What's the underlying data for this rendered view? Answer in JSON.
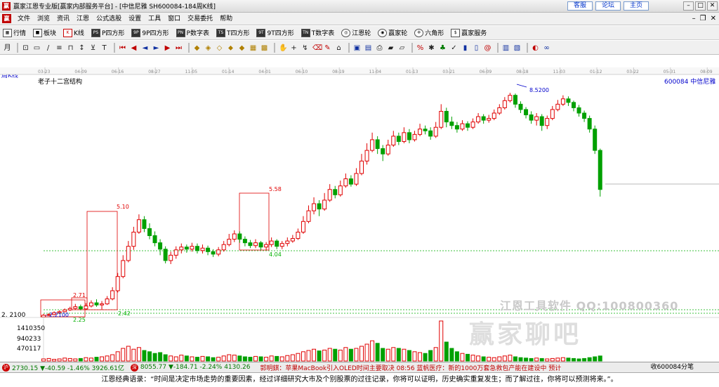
{
  "window": {
    "title": "赢家江恩专业版[赢家内部服务平台] - [中信尼雅  SH600084-184周K线]",
    "links": [
      "客服",
      "论坛",
      "主页"
    ]
  },
  "menu": [
    "文件",
    "浏览",
    "资讯",
    "江恩",
    "公式选股",
    "设置",
    "工具",
    "窗口",
    "交易委托",
    "帮助"
  ],
  "toolbar1": [
    {
      "icon": "grid-icon",
      "glyph": "▦",
      "label": "行情"
    },
    {
      "icon": "blocks-icon",
      "glyph": "■",
      "label": "板块"
    },
    {
      "icon": "kline-icon",
      "glyph": "K",
      "label": "K线"
    },
    {
      "icon": "p-square-icon",
      "glyph": "PS",
      "label": "P四方形"
    },
    {
      "icon": "9p-square-icon",
      "glyph": "9P",
      "label": "9P四方形"
    },
    {
      "icon": "p-number-table-icon",
      "glyph": "PN",
      "label": "P数字表"
    },
    {
      "icon": "t-square-icon",
      "glyph": "TS",
      "label": "T四方形"
    },
    {
      "icon": "9t-square-icon",
      "glyph": "9T",
      "label": "9T四方形"
    },
    {
      "icon": "t-number-table-icon",
      "glyph": "TN",
      "label": "T数字表"
    },
    {
      "icon": "gann-wheel-icon",
      "glyph": "◎",
      "label": "江恩轮"
    },
    {
      "icon": "winner-wheel-icon",
      "glyph": "◉",
      "label": "赢家轮"
    },
    {
      "icon": "hexagon-icon",
      "glyph": "✡",
      "label": "六角形"
    },
    {
      "icon": "dollar-icon",
      "glyph": "$",
      "label": "赢家服务"
    }
  ],
  "chart": {
    "period_label": "周K线",
    "title": "老子十二宫结构",
    "stock": "600084  中信尼雅",
    "date_axis": [
      "03-23",
      "04-09",
      "06-16",
      "08-27",
      "11-05",
      "01-14",
      "04-01",
      "06-10",
      "08-19",
      "11-04",
      "01-13",
      "03-21",
      "06-09",
      "08-18",
      "11-03",
      "01-12",
      "03-22",
      "05-31",
      "08-09"
    ],
    "price_left_label": "2. 2100",
    "volume_labels": [
      "1410350",
      "940233",
      "470117"
    ],
    "watermark": "江恩工具软件  QQ:100800360",
    "watermark_logo": "赢家聊吧"
  },
  "chart_data": {
    "type": "candlestick",
    "unit": "weekly",
    "annotations": {
      "peak": "8.5200",
      "box1_low": "2.2100",
      "box1_low_b": "2.25",
      "box2_top": "2.71",
      "box2_bottom": "2.42",
      "box3_top": "5.10",
      "box4_top": "5.58",
      "box4_bottom": "4.04"
    },
    "ylim": [
      2.0,
      8.8
    ],
    "candles": [
      [
        2.21,
        2.26,
        2.2,
        2.3
      ],
      [
        2.26,
        2.28,
        2.24,
        2.32
      ],
      [
        2.28,
        2.33,
        2.26,
        2.37
      ],
      [
        2.33,
        2.36,
        2.3,
        2.4
      ],
      [
        2.36,
        2.41,
        2.34,
        2.45
      ],
      [
        2.41,
        2.45,
        2.38,
        2.5
      ],
      [
        2.45,
        2.5,
        2.42,
        2.58
      ],
      [
        2.5,
        2.44,
        2.4,
        2.56
      ],
      [
        2.44,
        2.52,
        2.42,
        2.6
      ],
      [
        2.52,
        2.61,
        2.48,
        2.68
      ],
      [
        2.61,
        2.55,
        2.5,
        2.71
      ],
      [
        2.55,
        2.58,
        2.42,
        2.66
      ],
      [
        2.58,
        2.72,
        2.55,
        2.8
      ],
      [
        2.72,
        2.95,
        2.68,
        3.05
      ],
      [
        2.95,
        3.35,
        2.9,
        3.45
      ],
      [
        3.35,
        3.8,
        3.3,
        3.95
      ],
      [
        3.8,
        4.2,
        3.75,
        4.35
      ],
      [
        4.2,
        4.6,
        4.1,
        4.75
      ],
      [
        4.6,
        4.95,
        4.55,
        5.1
      ],
      [
        4.95,
        4.7,
        4.6,
        5.05
      ],
      [
        4.7,
        4.5,
        4.4,
        4.85
      ],
      [
        4.5,
        4.3,
        4.2,
        4.62
      ],
      [
        4.3,
        4.12,
        3.95,
        4.4
      ],
      [
        4.12,
        3.8,
        3.72,
        4.2
      ],
      [
        3.8,
        3.95,
        3.7,
        4.05
      ],
      [
        3.95,
        4.1,
        3.85,
        4.2
      ],
      [
        4.1,
        4.18,
        4.0,
        4.28
      ],
      [
        4.18,
        4.12,
        4.02,
        4.25
      ],
      [
        4.12,
        4.2,
        4.05,
        4.3
      ],
      [
        4.2,
        4.08,
        4.0,
        4.28
      ],
      [
        4.08,
        4.15,
        4.0,
        4.25
      ],
      [
        4.15,
        4.05,
        3.95,
        4.22
      ],
      [
        4.05,
        3.98,
        3.9,
        4.12
      ],
      [
        3.98,
        4.1,
        3.92,
        4.18
      ],
      [
        4.1,
        4.25,
        4.05,
        4.35
      ],
      [
        4.25,
        4.4,
        4.2,
        4.55
      ],
      [
        4.4,
        4.55,
        4.32,
        4.65
      ],
      [
        4.55,
        4.4,
        4.3,
        4.62
      ],
      [
        4.4,
        4.3,
        4.2,
        4.48
      ],
      [
        4.3,
        4.22,
        4.15,
        4.38
      ],
      [
        4.22,
        4.3,
        4.15,
        4.4
      ],
      [
        4.3,
        4.18,
        4.1,
        4.35
      ],
      [
        4.18,
        4.25,
        4.1,
        4.32
      ],
      [
        4.25,
        4.35,
        4.18,
        4.45
      ],
      [
        4.35,
        4.2,
        4.12,
        4.4
      ],
      [
        4.2,
        4.28,
        4.12,
        4.35
      ],
      [
        4.28,
        4.35,
        4.2,
        4.45
      ],
      [
        4.35,
        4.42,
        4.3,
        4.52
      ],
      [
        4.42,
        4.6,
        4.38,
        4.7
      ],
      [
        4.6,
        4.9,
        4.55,
        5.05
      ],
      [
        4.9,
        5.2,
        4.85,
        5.35
      ],
      [
        5.2,
        5.4,
        5.1,
        5.58
      ],
      [
        5.4,
        5.25,
        5.05,
        5.5
      ],
      [
        5.25,
        5.5,
        5.2,
        5.7
      ],
      [
        5.5,
        5.8,
        5.45,
        5.95
      ],
      [
        5.8,
        5.65,
        5.55,
        5.9
      ],
      [
        5.65,
        5.9,
        5.6,
        6.05
      ],
      [
        5.9,
        6.1,
        5.85,
        6.25
      ],
      [
        6.1,
        5.95,
        5.88,
        6.2
      ],
      [
        5.95,
        6.25,
        5.9,
        6.4
      ],
      [
        6.25,
        6.6,
        6.2,
        6.8
      ],
      [
        6.6,
        6.9,
        6.5,
        7.1
      ],
      [
        6.9,
        7.2,
        6.85,
        7.4
      ],
      [
        7.2,
        6.95,
        6.8,
        7.3
      ],
      [
        6.95,
        6.8,
        6.6,
        7.05
      ],
      [
        6.8,
        7.05,
        6.75,
        7.2
      ],
      [
        7.05,
        7.3,
        7.0,
        7.45
      ],
      [
        7.3,
        7.15,
        7.05,
        7.4
      ],
      [
        7.15,
        7.4,
        7.1,
        7.55
      ],
      [
        7.4,
        7.2,
        7.1,
        7.5
      ],
      [
        7.2,
        7.35,
        7.15,
        7.45
      ],
      [
        7.35,
        7.5,
        7.3,
        7.65
      ],
      [
        7.5,
        7.45,
        7.35,
        7.6
      ],
      [
        7.45,
        7.3,
        7.2,
        7.55
      ],
      [
        7.3,
        7.55,
        7.25,
        7.7
      ],
      [
        7.55,
        8.0,
        7.5,
        8.2
      ],
      [
        8.0,
        7.7,
        7.55,
        8.1
      ],
      [
        7.7,
        7.6,
        7.5,
        7.85
      ],
      [
        7.6,
        7.5,
        7.4,
        7.7
      ],
      [
        7.5,
        7.65,
        7.45,
        7.75
      ],
      [
        7.65,
        7.55,
        7.45,
        7.72
      ],
      [
        7.55,
        7.7,
        7.5,
        7.8
      ],
      [
        7.7,
        7.85,
        7.65,
        7.95
      ],
      [
        7.85,
        7.75,
        7.65,
        7.92
      ],
      [
        7.75,
        7.8,
        7.68,
        7.9
      ],
      [
        7.8,
        7.95,
        7.75,
        8.05
      ],
      [
        7.95,
        8.1,
        7.9,
        8.2
      ],
      [
        8.1,
        8.3,
        8.05,
        8.4
      ],
      [
        8.3,
        8.45,
        8.25,
        8.52
      ],
      [
        8.45,
        8.2,
        8.1,
        8.5
      ],
      [
        8.2,
        8.05,
        7.95,
        8.28
      ],
      [
        8.05,
        7.9,
        7.8,
        8.12
      ],
      [
        7.9,
        7.75,
        7.65,
        8.0
      ],
      [
        7.75,
        7.85,
        7.6,
        7.95
      ],
      [
        7.85,
        7.6,
        7.45,
        7.92
      ],
      [
        7.6,
        7.8,
        7.5,
        7.88
      ],
      [
        7.8,
        8.05,
        7.75,
        8.15
      ],
      [
        8.05,
        8.2,
        8.0,
        8.32
      ],
      [
        8.2,
        8.35,
        8.15,
        8.45
      ],
      [
        8.35,
        8.25,
        8.15,
        8.42
      ],
      [
        8.25,
        8.1,
        8.0,
        8.3
      ],
      [
        8.1,
        7.95,
        7.85,
        8.18
      ],
      [
        7.95,
        7.8,
        7.7,
        8.02
      ],
      [
        7.8,
        7.5,
        7.4,
        7.88
      ],
      [
        7.5,
        6.9,
        6.8,
        7.6
      ],
      [
        6.9,
        5.8,
        5.6,
        6.95
      ]
    ],
    "volume": [
      0.05,
      0.06,
      0.04,
      0.05,
      0.07,
      0.06,
      0.05,
      0.06,
      0.08,
      0.07,
      0.09,
      0.1,
      0.12,
      0.15,
      0.22,
      0.3,
      0.35,
      0.28,
      0.32,
      0.25,
      0.22,
      0.18,
      0.2,
      0.15,
      0.12,
      0.1,
      0.14,
      0.12,
      0.1,
      0.09,
      0.11,
      0.1,
      0.08,
      0.09,
      0.12,
      0.15,
      0.14,
      0.12,
      0.1,
      0.09,
      0.11,
      0.1,
      0.09,
      0.12,
      0.11,
      0.1,
      0.13,
      0.15,
      0.18,
      0.22,
      0.25,
      0.28,
      0.24,
      0.26,
      0.3,
      0.28,
      0.26,
      0.32,
      0.28,
      0.3,
      0.35,
      0.4,
      0.48,
      0.42,
      0.3,
      0.28,
      0.32,
      0.3,
      0.28,
      0.25,
      0.22,
      0.2,
      0.18,
      0.25,
      0.32,
      0.95,
      0.45,
      0.3,
      0.22,
      0.18,
      0.16,
      0.14,
      0.12,
      0.1,
      0.09,
      0.08,
      0.1,
      0.12,
      0.14,
      0.1,
      0.08,
      0.07,
      0.06,
      0.07,
      0.06,
      0.05,
      0.06,
      0.07,
      0.08,
      0.07,
      0.06,
      0.05,
      0.06,
      0.08,
      0.1,
      0.12
    ]
  },
  "statusbar": {
    "sh_index": "2730.15",
    "sh_change": "▼-40.59",
    "sh_pct": "-1.46%",
    "sh_amount": "3926.61亿",
    "sz_index": "8055.77",
    "sz_change": "▼-184.71",
    "sz_pct": "-2.24%",
    "sz_amount": "4130.26",
    "ticker": "郭明錤：苹果MacBook引入OLED时间主要取决     08:56  蓝帆医疗：新的1000万套急救包产能在建设中 预计",
    "right_text": "收600084分笔"
  },
  "quote": "江恩经典语录：“时间是决定市场走势的重要因素，经过详细研究大市及个别股票的过往记录，你将可以证明，历史确实重复发生；而了解过往，你将可以预测将来。”。",
  "colors": {
    "up": "#e00000",
    "down": "#00a000",
    "box": "#e00000",
    "dotted_green": "#00b000"
  }
}
